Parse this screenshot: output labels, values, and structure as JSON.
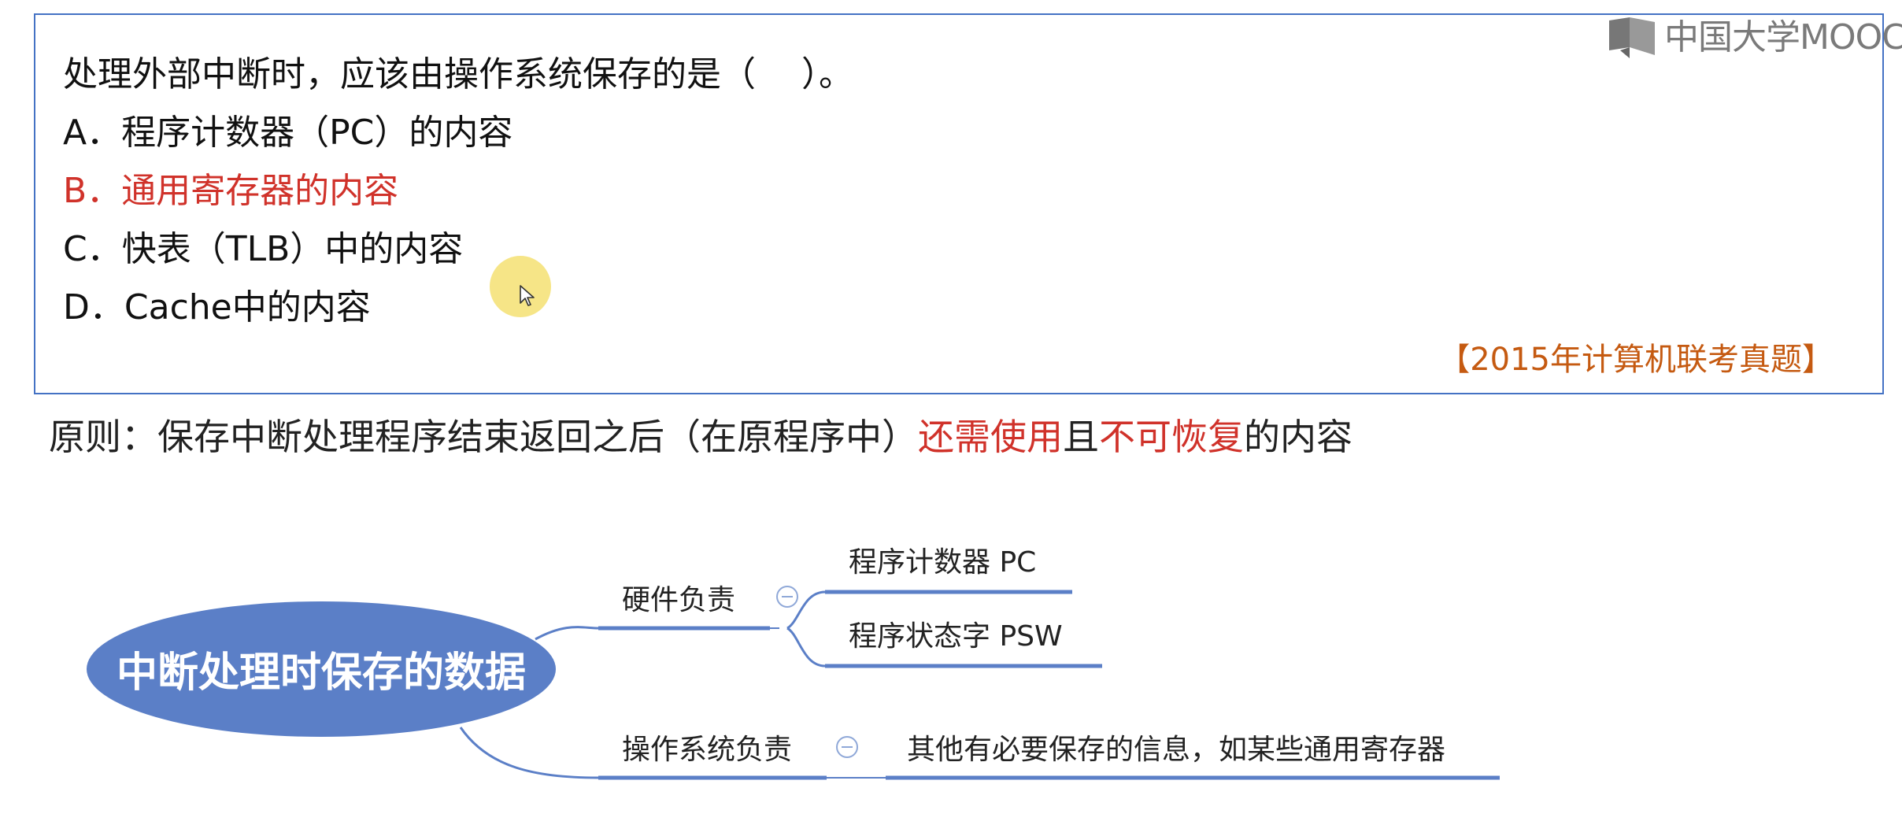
{
  "logo": {
    "text": "中国大学MOOC"
  },
  "question": {
    "stem": "处理外部中断时，应该由操作系统保存的是（　 ）。",
    "options": [
      {
        "text": "A．程序计数器（PC）的内容",
        "correct": false
      },
      {
        "text": "B．通用寄存器的内容",
        "correct": true
      },
      {
        "text": "C．快表（TLB）中的内容",
        "correct": false
      },
      {
        "text": "D．Cache中的内容",
        "correct": false
      }
    ],
    "source": "【2015年计算机联考真题】"
  },
  "principle": {
    "part1": "原则：保存中断处理程序结束返回之后（在原程序中）",
    "red1": "还需使用",
    "part2": "且",
    "red2": "不可恢复",
    "part3": "的内容"
  },
  "mindmap": {
    "root": "中断处理时保存的数据",
    "branch_hardware": "硬件负责",
    "hw_item1": "程序计数器 PC",
    "hw_item2": "程序状态字 PSW",
    "branch_os": "操作系统负责",
    "os_item1": "其他有必要保存的信息，如某些通用寄存器"
  },
  "colors": {
    "border": "#4472c4",
    "correct": "#d0322a",
    "source": "#c55a11",
    "root_fill": "#5b7fc7",
    "line": "#5b7fc7"
  }
}
